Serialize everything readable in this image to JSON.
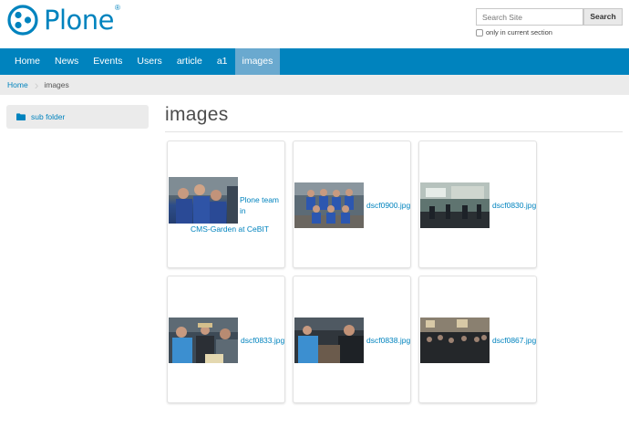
{
  "header": {
    "logo_text": "Plone",
    "logo_mark": "®",
    "search_placeholder": "Search Site",
    "search_button": "Search",
    "section_checkbox_label": "only in current section"
  },
  "nav": {
    "items": [
      "Home",
      "News",
      "Events",
      "Users",
      "article",
      "a1",
      "images"
    ],
    "active": "images"
  },
  "breadcrumbs": {
    "home": "Home",
    "current": "images"
  },
  "sidebar": {
    "items": [
      {
        "label": "sub folder",
        "icon": "folder-icon"
      }
    ]
  },
  "main": {
    "title": "images",
    "images": [
      {
        "caption_line1": "Plone team in",
        "caption_line2": "CMS-Garden at CeBIT"
      },
      {
        "caption": "dscf0900.jpg"
      },
      {
        "caption": "dscf0830.jpg"
      },
      {
        "caption": "dscf0833.jpg"
      },
      {
        "caption": "dscf0838.jpg"
      },
      {
        "caption": "dscf0867.jpg"
      }
    ]
  },
  "colors": {
    "accent": "#0083be",
    "nav_active": "#6aa9cf",
    "breadcrumb_bg": "#ebebeb"
  }
}
